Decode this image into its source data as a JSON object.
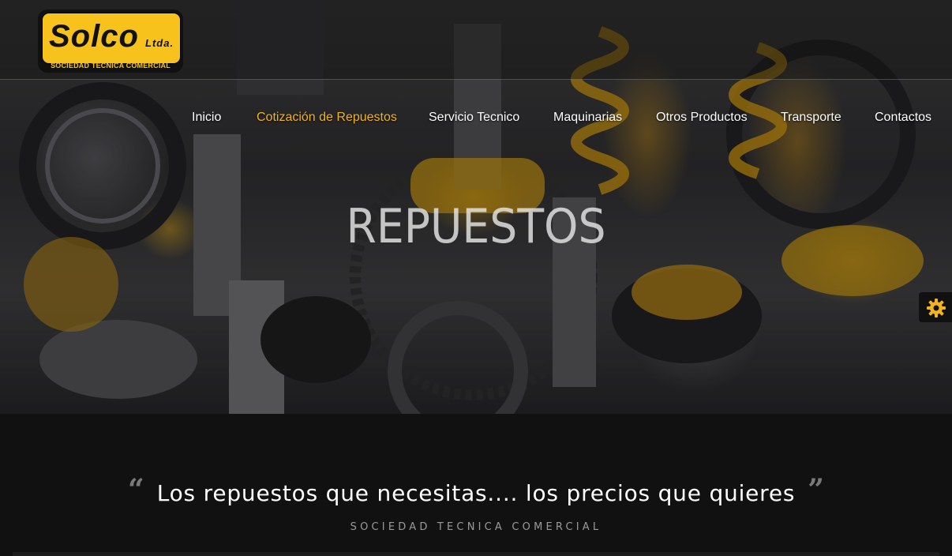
{
  "logo": {
    "word": "Solco",
    "suffix": "Ltda.",
    "tagline": "SOCIEDAD TECNICA COMERCIAL"
  },
  "nav": {
    "items": [
      {
        "label": "Inicio"
      },
      {
        "label": "Cotización de Repuestos",
        "active": true
      },
      {
        "label": "Servicio Tecnico"
      },
      {
        "label": "Maquinarias"
      },
      {
        "label": "Otros Productos"
      },
      {
        "label": "Transporte"
      },
      {
        "label": "Contactos"
      }
    ]
  },
  "hero": {
    "title": "REPUESTOS"
  },
  "settings": {
    "icon": "gear-icon",
    "color": "#f2b41c"
  },
  "quote": {
    "text": "Los repuestos que necesitas.... los precios que quieres",
    "subtitle": "SOCIEDAD TECNICA COMERCIAL",
    "open_icon": "quote-open-icon",
    "close_icon": "quote-close-icon"
  },
  "colors": {
    "accent": "#f2b41c",
    "logo_yellow": "#f7c21b",
    "band_background": "#111111"
  }
}
